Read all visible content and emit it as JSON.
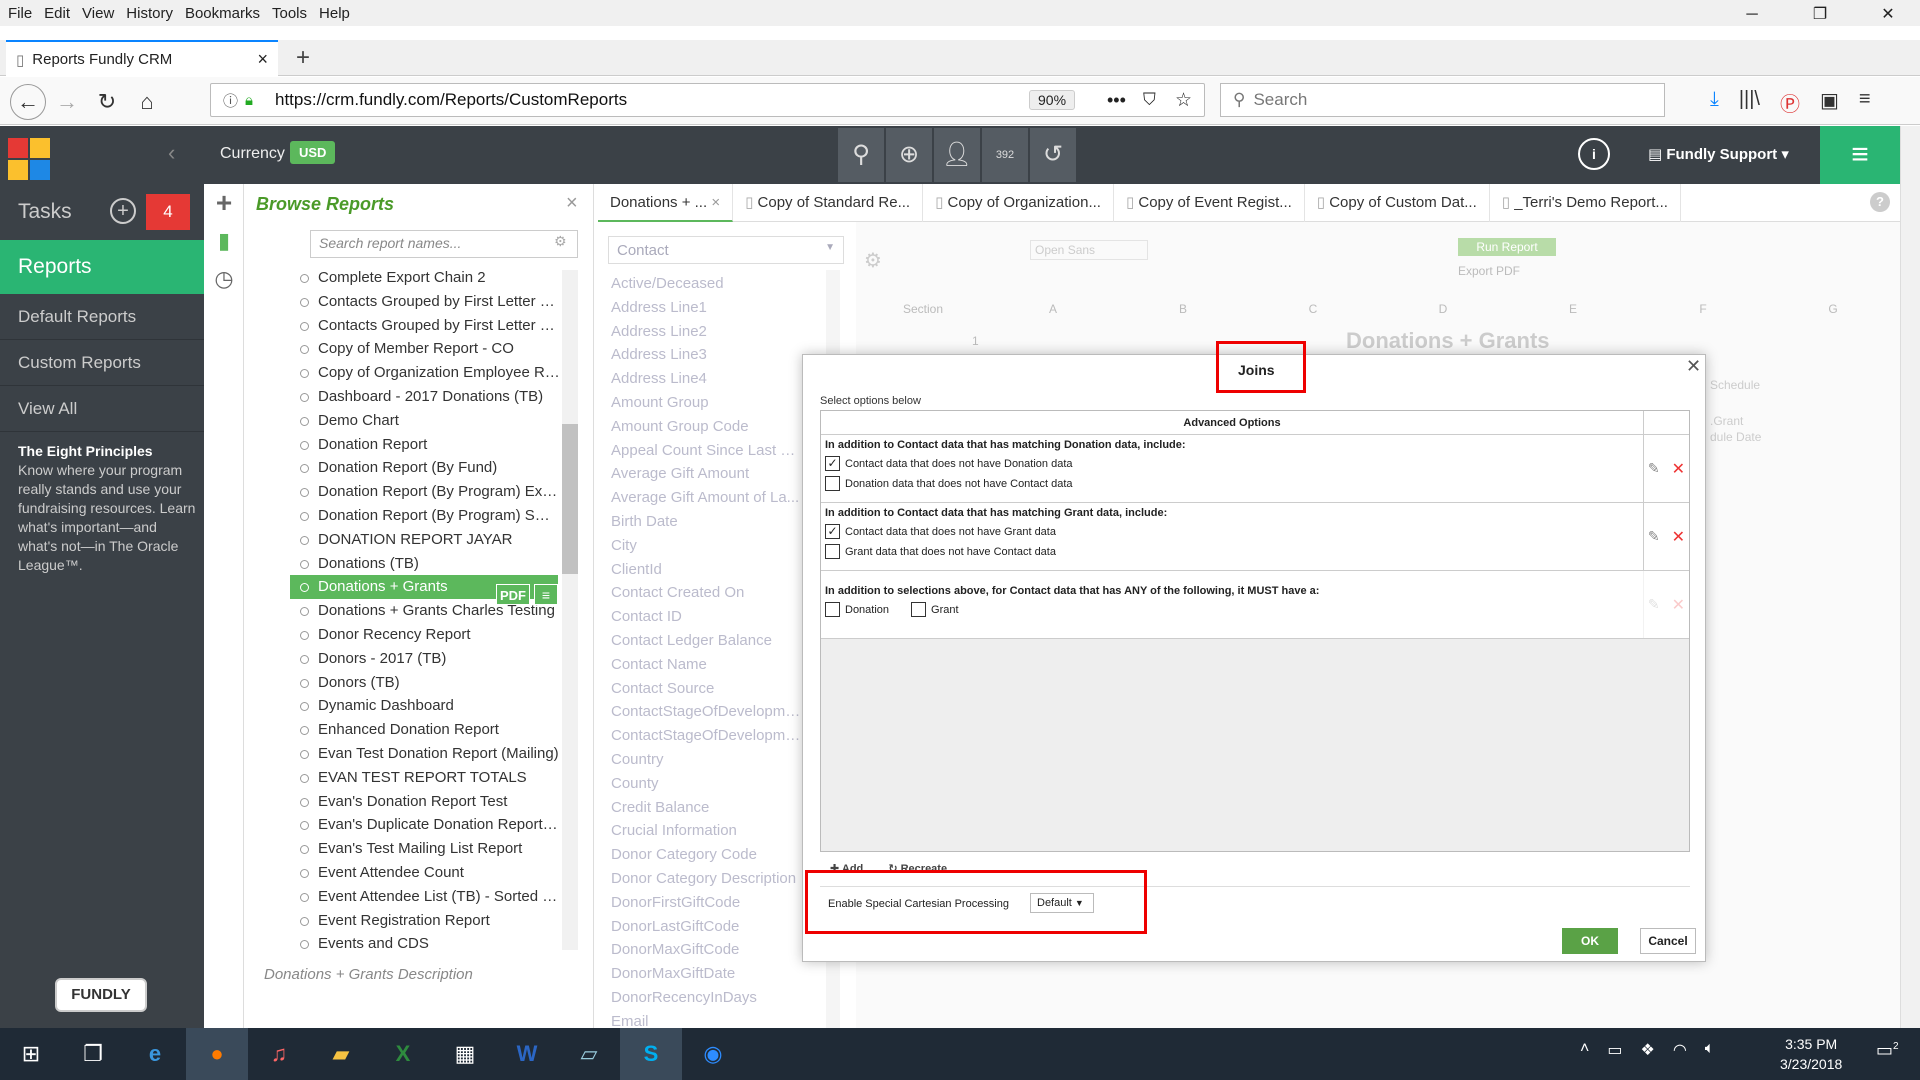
{
  "browser": {
    "menu": [
      "File",
      "Edit",
      "View",
      "History",
      "Bookmarks",
      "Tools",
      "Help"
    ],
    "tab_title": "Reports Fundly CRM",
    "url": "https://crm.fundly.com/Reports/CustomReports",
    "zoom": "90%",
    "search_placeholder": "Search"
  },
  "header": {
    "currency_label": "Currency",
    "currency_value": "USD",
    "user": "Fundly Support",
    "info": "i",
    "counter": "392"
  },
  "leftnav": {
    "tasks": "Tasks",
    "task_count": "4",
    "reports": "Reports",
    "items": [
      "Default Reports",
      "Custom Reports",
      "View All"
    ],
    "principles_title": "The Eight Principles",
    "principles_text": "Know where your program really stands and use your fundraising resources. Learn what's important—and what's not—in The Oracle League™.",
    "logo": "FUNDLY"
  },
  "browse": {
    "title": "Browse Reports",
    "search_placeholder": "Search report names...",
    "items": [
      "Complete Export Chain 2",
      "Contacts Grouped by First Letter of...",
      "Contacts Grouped by First Letter of...",
      "Copy of Member Report - CO",
      "Copy of Organization Employee Re...",
      "Dashboard - 2017 Donations (TB)",
      "Demo Chart",
      "Donation Report",
      "Donation Report (By Fund)",
      "Donation Report (By Program) Exa...",
      "Donation Report (By Program) SUP...",
      "DONATION REPORT JAYAR",
      "Donations (TB)",
      "Donations + Grants",
      "Donations + Grants Charles Testing",
      "Donor Recency Report",
      "Donors - 2017 (TB)",
      "Donors (TB)",
      "Dynamic Dashboard",
      "Enhanced Donation Report",
      "Evan Test Donation Report (Mailing)",
      "EVAN TEST REPORT TOTALS",
      "Evan's Donation Report Test",
      "Evan's Duplicate Donation Report T...",
      "Evan's Test Mailing List Report",
      "Event Attendee Count",
      "Event Attendee List (TB) - Sorted b...",
      "Event Registration Report",
      "Events and CDS"
    ],
    "pdf": "PDF",
    "description": "Donations + Grants Description"
  },
  "report_tabs": [
    "Donations + ...",
    "Copy of Standard Re...",
    "Copy of Organization...",
    "Copy of Event Regist...",
    "Copy of Custom Dat...",
    "_Terri's Demo Report..."
  ],
  "fields": {
    "selector": "Contact",
    "items": [
      "Active/Deceased",
      "Address Line1",
      "Address Line2",
      "Address Line3",
      "Address Line4",
      "Amount Group",
      "Amount Group Code",
      "Appeal Count Since Last R...",
      "Average Gift Amount",
      "Average Gift Amount of La...",
      "Birth Date",
      "City",
      "ClientId",
      "Contact Created On",
      "Contact ID",
      "Contact Ledger Balance",
      "Contact Name",
      "Contact Source",
      "ContactStageOfDevelopme...",
      "ContactStageOfDevelopme...",
      "Country",
      "County",
      "Credit Balance",
      "Crucial Information",
      "Donor Category Code",
      "Donor Category Description",
      "DonorFirstGiftCode",
      "DonorLastGiftCode",
      "DonorMaxGiftCode",
      "DonorMaxGiftDate",
      "DonorRecencyInDays",
      "Email"
    ]
  },
  "sheet": {
    "font": "Open Sans",
    "run_report": "Run Report",
    "export_pdf": "Export PDF",
    "columns": [
      "Section",
      "A",
      "B",
      "C",
      "D",
      "E",
      "F",
      "G"
    ],
    "title": "Donations + Grants",
    "row": "1",
    "peek1": "Schedule",
    "peek2": ".Grant",
    "peek3": "dule Date"
  },
  "modal": {
    "title": "Joins",
    "select_text": "Select options below",
    "header": "Advanced Options",
    "sections": [
      {
        "heading": "In addition to Contact data that has matching Donation data, include:",
        "opt1": "Contact data that does not have Donation data",
        "opt1_checked": true,
        "opt2": "Donation data that does not have Contact data",
        "opt2_checked": false
      },
      {
        "heading": "In addition to Contact data that has matching Grant data, include:",
        "opt1": "Contact data that does not have Grant data",
        "opt1_checked": true,
        "opt2": "Grant data that does not have Contact data",
        "opt2_checked": false
      },
      {
        "heading": "In addition to selections above, for Contact data that has ANY of the following, it MUST have a:",
        "opt1": "Donation",
        "opt2": "Grant"
      }
    ],
    "add": "Add",
    "recreate": "Recreate",
    "cartesian_label": "Enable Special Cartesian Processing",
    "cartesian_value": "Default",
    "ok": "OK",
    "cancel": "Cancel"
  },
  "taskbar": {
    "time": "3:35 PM",
    "date": "3/23/2018",
    "notif_count": "2"
  }
}
